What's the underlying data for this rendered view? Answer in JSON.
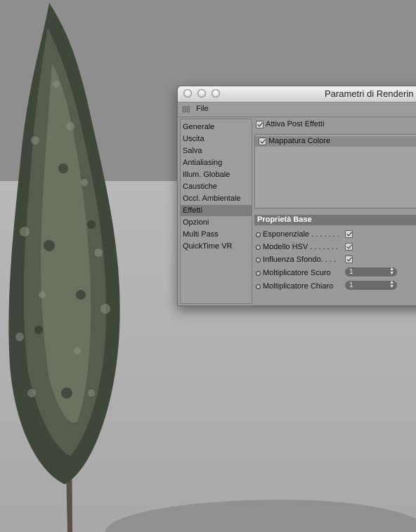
{
  "window": {
    "title": "Parametri di Renderin"
  },
  "menu": {
    "file": "File"
  },
  "sidebar": {
    "items": [
      {
        "label": "Generale"
      },
      {
        "label": "Uscita"
      },
      {
        "label": "Salva"
      },
      {
        "label": "Antialiasing"
      },
      {
        "label": "Illum. Globale"
      },
      {
        "label": "Caustiche"
      },
      {
        "label": "Occl. Ambientale"
      },
      {
        "label": "Effetti",
        "selected": true
      },
      {
        "label": "Opzioni"
      },
      {
        "label": "Multi Pass"
      },
      {
        "label": "QuickTime VR"
      }
    ]
  },
  "effects": {
    "post_effects_label": "Attiva Post Effetti",
    "post_effects_checked": true,
    "list": [
      {
        "label": "Mappatura Colore",
        "checked": true
      }
    ]
  },
  "properties": {
    "header": "Proprietà Base",
    "esponenziale_label": "Esponenziale . . . . . . .",
    "esponenziale_checked": true,
    "hsv_label": "Modello HSV  . . . . . . .",
    "hsv_checked": true,
    "sfondo_label": "Influenza Sfondo. . . .",
    "sfondo_checked": true,
    "scuro_label": "Moltiplicatore Scuro",
    "scuro_value": "1",
    "chiaro_label": "Moltiplicatore Chiaro",
    "chiaro_value": "1"
  },
  "icons": {
    "close": "close-window-icon",
    "minimize": "minimize-window-icon",
    "zoom": "zoom-window-icon",
    "grip": "menu-grip-icon",
    "stepper": "stepper-arrows-icon"
  },
  "colors": {
    "window_bg": "#9a9a9a",
    "selection": "#7d7d7d",
    "section_header": "#767676"
  }
}
